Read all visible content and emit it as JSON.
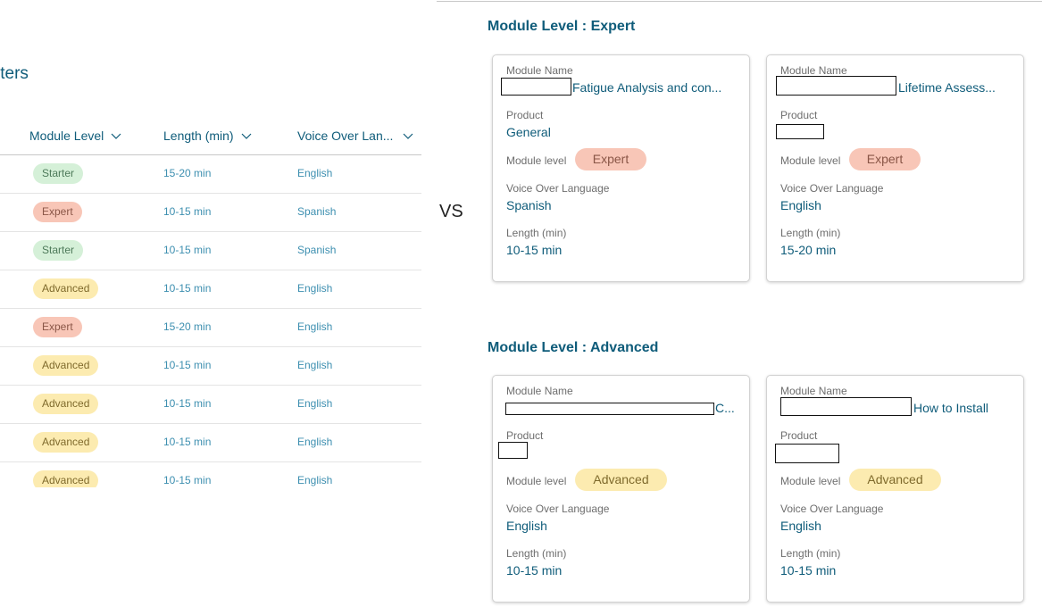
{
  "left": {
    "filters_title": "lters",
    "columns": {
      "level": "Module Level",
      "length": "Length (min)",
      "voice": "Voice Over Lan..."
    },
    "rows": [
      {
        "level": "Starter",
        "kind": "starter",
        "length": "15-20 min",
        "voice": "English"
      },
      {
        "level": "Expert",
        "kind": "expert",
        "length": "10-15 min",
        "voice": "Spanish"
      },
      {
        "level": "Starter",
        "kind": "starter",
        "length": "10-15 min",
        "voice": "Spanish"
      },
      {
        "level": "Advanced",
        "kind": "advanced",
        "length": "10-15 min",
        "voice": "English"
      },
      {
        "level": "Expert",
        "kind": "expert",
        "length": "15-20 min",
        "voice": "English"
      },
      {
        "level": "Advanced",
        "kind": "advanced",
        "length": "10-15 min",
        "voice": "English"
      },
      {
        "level": "Advanced",
        "kind": "advanced",
        "length": "10-15 min",
        "voice": "English"
      },
      {
        "level": "Advanced",
        "kind": "advanced",
        "length": "10-15 min",
        "voice": "English"
      },
      {
        "level": "Advanced",
        "kind": "advanced",
        "length": "10-15 min",
        "voice": "English"
      }
    ]
  },
  "vs_label": "VS",
  "labels": {
    "module_name": "Module Name",
    "product": "Product",
    "module_level": "Module level",
    "voice_over": "Voice Over Language",
    "length": "Length (min)"
  },
  "expert_section": {
    "title": "Module Level : Expert",
    "cards": [
      {
        "name": "Fatigue Analysis and con...",
        "product": "General",
        "level": "Expert",
        "voice": "Spanish",
        "length": "10-15 min"
      },
      {
        "name": "Lifetime Assess...",
        "product": "",
        "level": "Expert",
        "voice": "English",
        "length": "15-20 min"
      }
    ]
  },
  "advanced_section": {
    "title": "Module Level : Advanced",
    "cards": [
      {
        "name": "C...",
        "product": "",
        "level": "Advanced",
        "voice": "English",
        "length": "10-15 min"
      },
      {
        "name": "How to Install",
        "product": "",
        "level": "Advanced",
        "voice": "English",
        "length": "10-15 min"
      }
    ]
  }
}
